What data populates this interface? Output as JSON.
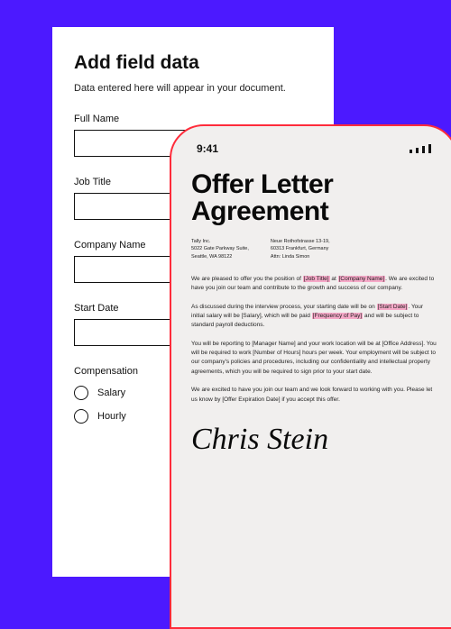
{
  "form": {
    "title": "Add field data",
    "subtitle": "Data entered here will appear in your document.",
    "fields": {
      "full_name_label": "Full Name",
      "job_title_label": "Job Title",
      "company_name_label": "Company Name",
      "start_date_label": "Start Date",
      "compensation_label": "Compensation"
    },
    "radios": {
      "salary": "Salary",
      "hourly": "Hourly"
    }
  },
  "phone": {
    "status_time": "9:41",
    "doc_title_line1": "Offer Letter",
    "doc_title_line2": "Agreement",
    "sender": {
      "name": "Tally Inc.",
      "line1": "5022 Gate Parkway Suite,",
      "line2": "Seattle, WA 98122"
    },
    "recipient": {
      "line1": "Neue Rothofstrasse 13-19,",
      "line2": "60313 Frankfurt, Germany",
      "line3": "Attn: Linda Simon"
    },
    "body": {
      "p1a": "We are pleased to offer you the position of ",
      "p1_jobtitle": "[Job Title]",
      "p1b": " at ",
      "p1_company": "[Company Name]",
      "p1c": ". We are excited to have you join our team and contribute to the growth and success of our company.",
      "p2a": "As discussed during the interview process, your starting date will be on ",
      "p2_start": "[Start Date]",
      "p2b": ". Your initial salary will be [Salary], which will be paid ",
      "p2_freq": "[Frequency of Pay]",
      "p2c": " and will be subject to standard payroll deductions.",
      "p3": "You will be reporting to [Manager Name] and your work location will be at [Office Address]. You will be required to work [Number of Hours] hours per week. Your employment will be subject to our company's policies and procedures, including our confidentiality and intellectual property agreements, which you will be required to sign prior to your start date.",
      "p4": "We are excited to have you join our team and we look forward to working with you. Please let us know by [Offer Expiration Date] if you accept this offer."
    },
    "signature": "Chris Stein"
  }
}
